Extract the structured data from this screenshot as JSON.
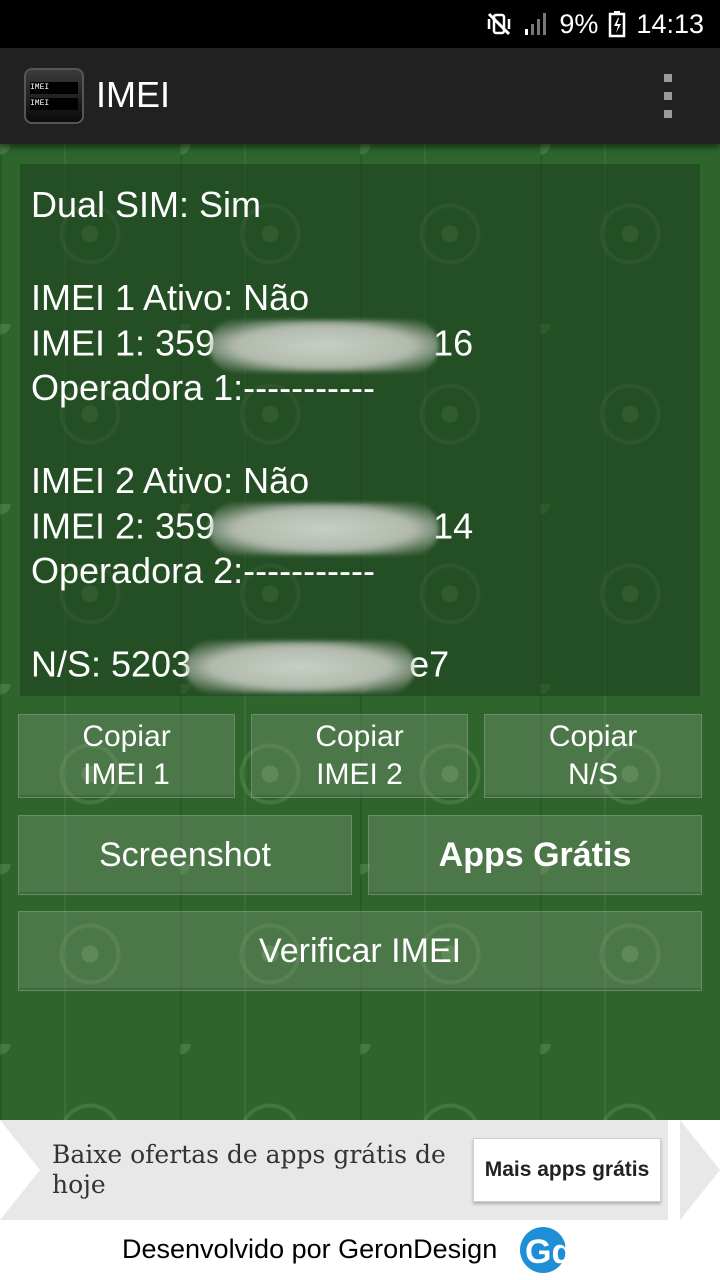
{
  "status_bar": {
    "battery": "9%",
    "time": "14:13",
    "icons": [
      "mute-vibrate-icon",
      "signal-icon",
      "battery-icon"
    ]
  },
  "app_bar": {
    "title": "IMEI",
    "logo_text": [
      "IMEI 489288084",
      "IMEI 489288084"
    ],
    "menu_icon": "overflow-menu-icon"
  },
  "info": {
    "dual_sim": "Dual SIM:  Sim",
    "imei1_active": "IMEI 1 Ativo:  Não",
    "imei1_prefix": "IMEI 1:  359",
    "imei1_suffix": "16",
    "operator1": "Operadora 1:-----------",
    "imei2_active": "IMEI 2 Ativo:  Não",
    "imei2_prefix": "IMEI 2:  359",
    "imei2_suffix": "14",
    "operator2": "Operadora 2:-----------",
    "serial_prefix": "N/S:  5203",
    "serial_suffix": "e7"
  },
  "buttons": {
    "copy_imei1": [
      "Copiar",
      "IMEI 1"
    ],
    "copy_imei2": [
      "Copiar",
      "IMEI 2"
    ],
    "copy_ns": [
      "Copiar",
      "N/S"
    ],
    "screenshot": "Screenshot",
    "free_apps": "Apps Grátis",
    "verify_imei": "Verificar IMEI"
  },
  "ad": {
    "text": "Baixe ofertas de apps grátis de hoje",
    "button": "Mais apps grátis"
  },
  "footer": {
    "text": "Desenvolvido por GeronDesign",
    "logo_text": "Gd"
  },
  "colors": {
    "status_bar": "#000000",
    "app_bar": "#212121",
    "background_green": "#2d652d",
    "logo_blue": "#1e8fd6"
  }
}
